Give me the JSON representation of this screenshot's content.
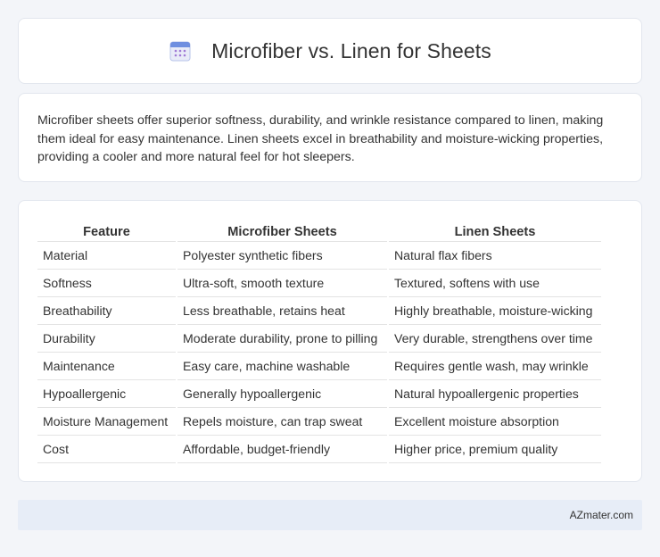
{
  "header": {
    "title": "Microfiber vs. Linen for Sheets",
    "icon": "calendar-icon"
  },
  "description": "Microfiber sheets offer superior softness, durability, and wrinkle resistance compared to linen, making them ideal for easy maintenance. Linen sheets excel in breathability and moisture-wicking properties, providing a cooler and more natural feel for hot sleepers.",
  "table": {
    "headers": [
      "Feature",
      "Microfiber Sheets",
      "Linen Sheets"
    ],
    "rows": [
      [
        "Material",
        "Polyester synthetic fibers",
        "Natural flax fibers"
      ],
      [
        "Softness",
        "Ultra-soft, smooth texture",
        "Textured, softens with use"
      ],
      [
        "Breathability",
        "Less breathable, retains heat",
        "Highly breathable, moisture-wicking"
      ],
      [
        "Durability",
        "Moderate durability, prone to pilling",
        "Very durable, strengthens over time"
      ],
      [
        "Maintenance",
        "Easy care, machine washable",
        "Requires gentle wash, may wrinkle"
      ],
      [
        "Hypoallergenic",
        "Generally hypoallergenic",
        "Natural hypoallergenic properties"
      ],
      [
        "Moisture Management",
        "Repels moisture, can trap sweat",
        "Excellent moisture absorption"
      ],
      [
        "Cost",
        "Affordable, budget-friendly",
        "Higher price, premium quality"
      ]
    ]
  },
  "footer": {
    "source": "AZmater.com"
  },
  "colors": {
    "background": "#f3f5f9",
    "card": "#ffffff",
    "footer_bg": "#e7edf7",
    "icon_accent": "#5b7fd8"
  }
}
